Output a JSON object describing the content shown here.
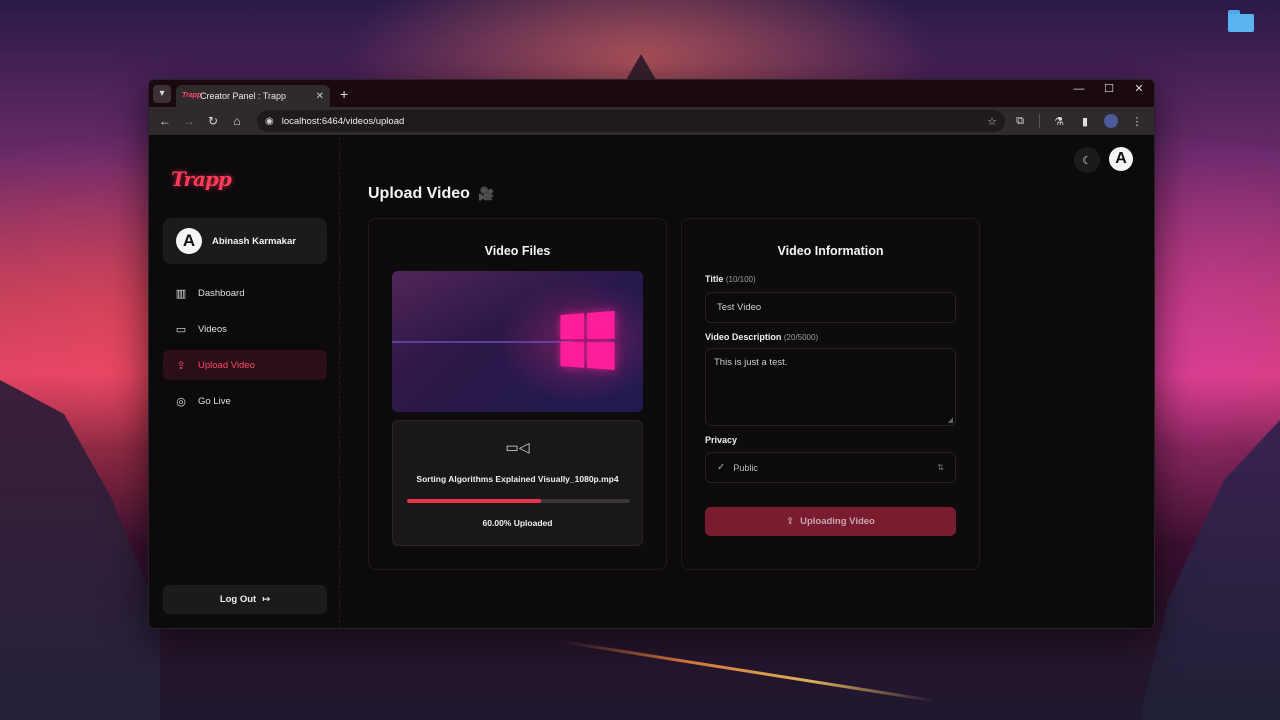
{
  "browser": {
    "tab_title": "Creator Panel : Trapp",
    "tab_favicon": "Trapp",
    "url": "localhost:6464/videos/upload",
    "icons": {
      "tab_dropdown": "▾",
      "tab_close": "✕",
      "new_tab": "+",
      "minimize": "—",
      "maximize": "☐",
      "close": "✕",
      "back": "←",
      "forward": "→",
      "reload": "↻",
      "home": "⌂",
      "site_info": "◉",
      "bookmark": "☆",
      "extensions": "⧉",
      "labs": "⚗",
      "side_panel": "▮",
      "menu": "⋮"
    }
  },
  "sidebar": {
    "logo": "Trapp",
    "profile": {
      "avatar_letter": "A",
      "name": "Abinash Karmakar"
    },
    "items": [
      {
        "label": "Dashboard",
        "icon": "▥"
      },
      {
        "label": "Videos",
        "icon": "▭"
      },
      {
        "label": "Upload Video",
        "icon": "⇪"
      },
      {
        "label": "Go Live",
        "icon": "◎"
      }
    ],
    "logout_label": "Log Out",
    "logout_icon": "↦"
  },
  "header": {
    "theme_icon": "☾",
    "avatar_letter": "A"
  },
  "main": {
    "title": "Upload Video",
    "title_icon": "🎥",
    "files_card": {
      "title": "Video Files",
      "upload_icon": "▭◁",
      "filename": "Sorting Algorithms Explained Visually_1080p.mp4",
      "progress": 0.6,
      "status": "60.00% Uploaded"
    },
    "info_card": {
      "title": "Video Information",
      "title_label": "Title",
      "title_count": "(10/100)",
      "title_value": "Test Video",
      "desc_label": "Video Description",
      "desc_count": "(20/5000)",
      "desc_value": "This is just a test.",
      "privacy_label": "Privacy",
      "privacy_value": "Public",
      "privacy_icon": "✓",
      "privacy_arrows": "⇅",
      "submit_label": "Uploading Video",
      "submit_icon": "⇪"
    }
  },
  "colors": {
    "accent": "#ff4a6a",
    "progress": "#e8344e",
    "submit_bg": "#7a1c30"
  }
}
